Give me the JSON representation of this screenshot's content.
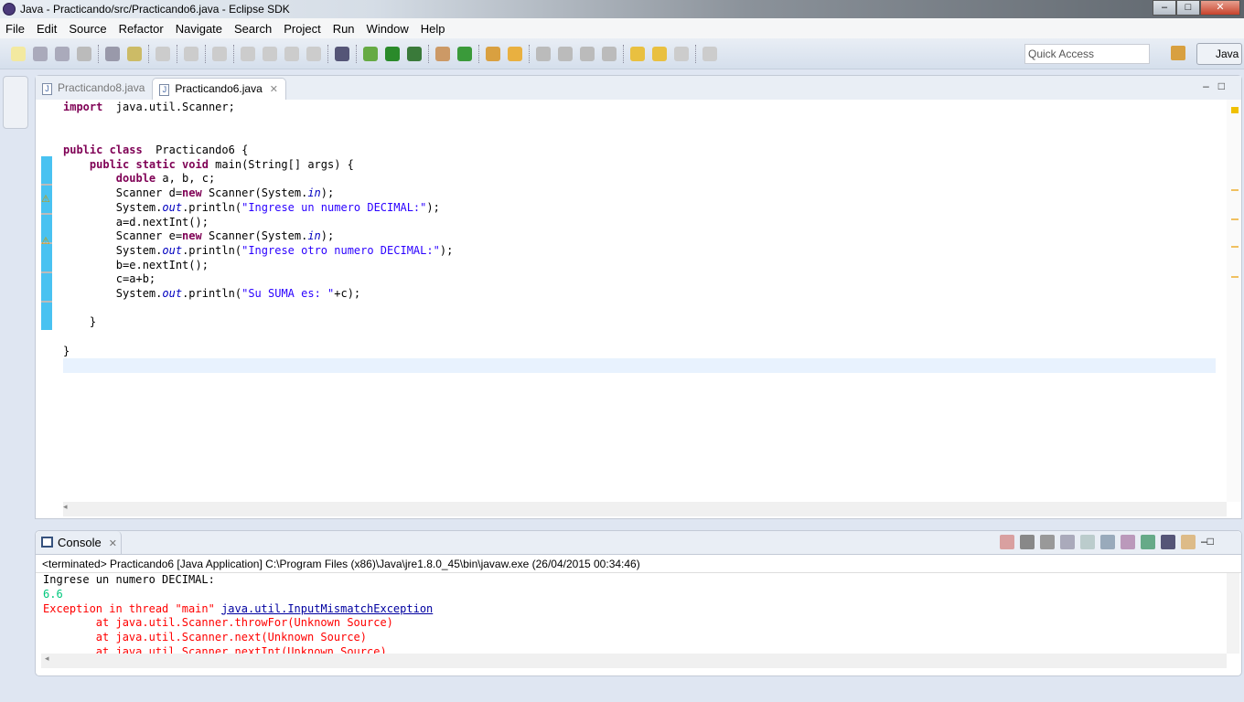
{
  "window": {
    "title": "Java - Practicando/src/Practicando6.java - Eclipse SDK"
  },
  "menu": [
    "File",
    "Edit",
    "Source",
    "Refactor",
    "Navigate",
    "Search",
    "Project",
    "Run",
    "Window",
    "Help"
  ],
  "toolbar": {
    "quick_access_placeholder": "Quick Access",
    "perspective": "Java"
  },
  "editor": {
    "tabs": [
      {
        "label": "Practicando8.java",
        "active": false
      },
      {
        "label": "Practicando6.java",
        "active": true
      }
    ],
    "lines": [
      [
        [
          "kw",
          "import"
        ],
        [
          "",
          "  java.util.Scanner;"
        ]
      ],
      [],
      [],
      [
        [
          "kw",
          "public class"
        ],
        [
          "",
          "  Practicando6 {"
        ]
      ],
      [
        [
          "",
          "    "
        ],
        [
          "kw",
          "public static void"
        ],
        [
          "",
          " main(String[] args) {"
        ]
      ],
      [
        [
          "",
          "        "
        ],
        [
          "kw",
          "double"
        ],
        [
          "",
          " a, b, c;"
        ]
      ],
      [
        [
          "",
          "        Scanner d="
        ],
        [
          "kw",
          "new"
        ],
        [
          "",
          " Scanner(System."
        ],
        [
          "it",
          "in"
        ],
        [
          "",
          ");"
        ]
      ],
      [
        [
          "",
          "        System."
        ],
        [
          "it",
          "out"
        ],
        [
          "",
          ".println("
        ],
        [
          "str",
          "\"Ingrese un numero DECIMAL:\""
        ],
        [
          "",
          ");"
        ]
      ],
      [
        [
          "",
          "        a=d.nextInt();"
        ]
      ],
      [
        [
          "",
          "        Scanner e="
        ],
        [
          "kw",
          "new"
        ],
        [
          "",
          " Scanner(System."
        ],
        [
          "it",
          "in"
        ],
        [
          "",
          ");"
        ]
      ],
      [
        [
          "",
          "        System."
        ],
        [
          "it",
          "out"
        ],
        [
          "",
          ".println("
        ],
        [
          "str",
          "\"Ingrese otro numero DECIMAL:\""
        ],
        [
          "",
          ");"
        ]
      ],
      [
        [
          "",
          "        b=e.nextInt();"
        ]
      ],
      [
        [
          "",
          "        c=a+b;"
        ]
      ],
      [
        [
          "",
          "        System."
        ],
        [
          "it",
          "out"
        ],
        [
          "",
          ".println("
        ],
        [
          "str",
          "\"Su SUMA es: \""
        ],
        [
          "",
          "+c);"
        ]
      ],
      [],
      [
        [
          "",
          "    }"
        ]
      ],
      [],
      [
        [
          "",
          "}"
        ]
      ],
      []
    ]
  },
  "console": {
    "tab_label": "Console",
    "description": "<terminated> Practicando6 [Java Application] C:\\Program Files (x86)\\Java\\jre1.8.0_45\\bin\\javaw.exe (26/04/2015 00:34:46)",
    "output": [
      {
        "type": "out",
        "text": "Ingrese un numero DECIMAL:"
      },
      {
        "type": "in",
        "text": "6.6"
      },
      {
        "type": "err",
        "text": "Exception in thread \"main\" ",
        "link": "java.util.InputMismatchException"
      },
      {
        "type": "err",
        "text": "        at java.util.Scanner.throwFor(Unknown Source)"
      },
      {
        "type": "err",
        "text": "        at java.util.Scanner.next(Unknown Source)"
      },
      {
        "type": "err",
        "text": "        at java.util.Scanner.nextInt(Unknown Source)"
      }
    ]
  },
  "colors": {
    "keyword": "#7f0055",
    "string": "#2a00ff",
    "static_field": "#0000c0",
    "error": "#ff0000",
    "input": "#00c87d"
  }
}
